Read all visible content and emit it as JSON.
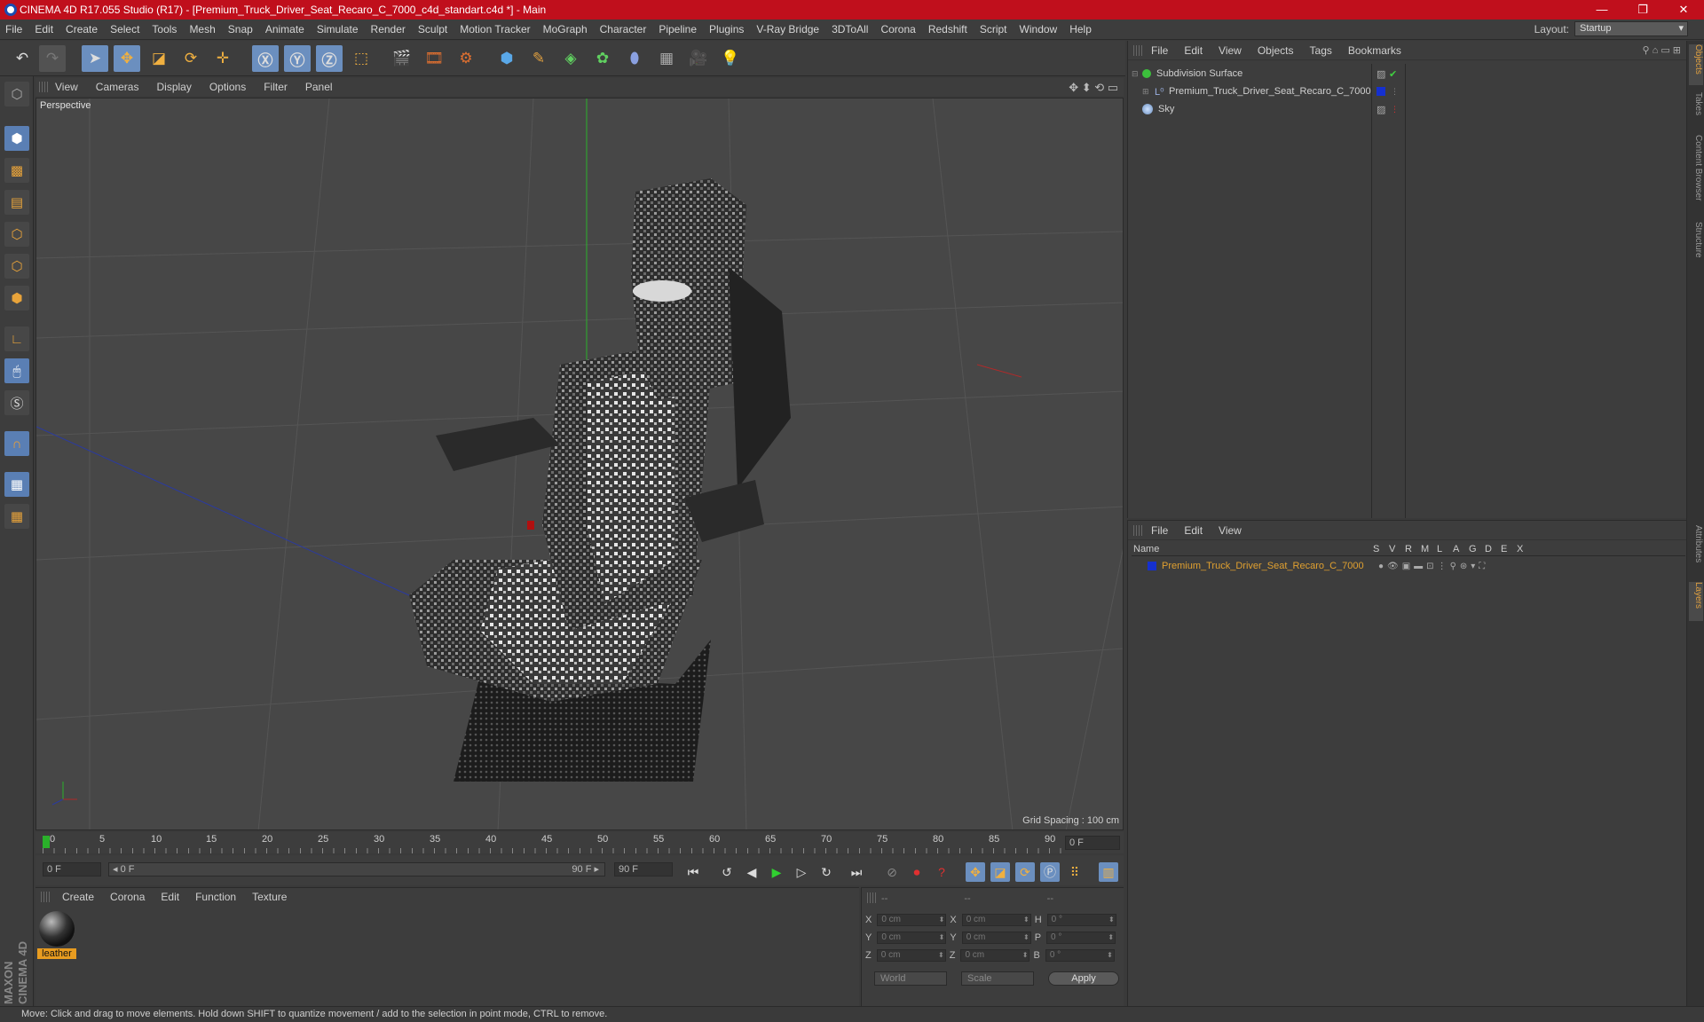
{
  "window": {
    "title": "CINEMA 4D R17.055 Studio (R17) - [Premium_Truck_Driver_Seat_Recaro_C_7000_c4d_standart.c4d *] - Main",
    "minimize": "—",
    "maximize": "❐",
    "close": "✕"
  },
  "menu": [
    "File",
    "Edit",
    "Create",
    "Select",
    "Tools",
    "Mesh",
    "Snap",
    "Animate",
    "Simulate",
    "Render",
    "Sculpt",
    "Motion Tracker",
    "MoGraph",
    "Character",
    "Pipeline",
    "Plugins",
    "V-Ray Bridge",
    "3DToAll",
    "Corona",
    "Redshift",
    "Script",
    "Window",
    "Help"
  ],
  "layout": {
    "label": "Layout:",
    "value": "Startup"
  },
  "viewport": {
    "menu": [
      "View",
      "Cameras",
      "Display",
      "Options",
      "Filter",
      "Panel"
    ],
    "label": "Perspective",
    "grid_spacing": "Grid Spacing : 100 cm",
    "nav_icons": "✥ ⬍ ⟲ ▭"
  },
  "timeline": {
    "ticks": [
      "0",
      "5",
      "10",
      "15",
      "20",
      "25",
      "30",
      "35",
      "40",
      "45",
      "50",
      "55",
      "60",
      "65",
      "70",
      "75",
      "80",
      "85",
      "90"
    ],
    "frame_field": "0 F",
    "start_field": "0 F",
    "slider_left": "◂ 0 F",
    "slider_right": "90 F ▸",
    "end_field": "90 F"
  },
  "materials": {
    "menu": [
      "Create",
      "Corona",
      "Edit",
      "Function",
      "Texture"
    ],
    "items": [
      {
        "name": "leather"
      }
    ]
  },
  "coords": {
    "headers": [
      "--",
      "--",
      "--"
    ],
    "rows": [
      {
        "a": "X",
        "av": "0 cm",
        "b": "X",
        "bv": "0 cm",
        "c": "H",
        "cv": "0 °"
      },
      {
        "a": "Y",
        "av": "0 cm",
        "b": "Y",
        "bv": "0 cm",
        "c": "P",
        "cv": "0 °"
      },
      {
        "a": "Z",
        "av": "0 cm",
        "b": "Z",
        "bv": "0 cm",
        "c": "B",
        "cv": "0 °"
      }
    ],
    "world": "World",
    "scale": "Scale",
    "apply": "Apply"
  },
  "objects": {
    "menu": [
      "File",
      "Edit",
      "View",
      "Objects",
      "Tags",
      "Bookmarks"
    ],
    "items": [
      {
        "name": "Subdivision Surface"
      },
      {
        "name": "Premium_Truck_Driver_Seat_Recaro_C_7000"
      },
      {
        "name": "Sky"
      }
    ]
  },
  "layers": {
    "menu": [
      "File",
      "Edit",
      "View"
    ],
    "columns": [
      "Name",
      "S",
      "V",
      "R",
      "M",
      "L",
      "A",
      "G",
      "D",
      "E",
      "X"
    ],
    "items": [
      {
        "name": "Premium_Truck_Driver_Seat_Recaro_C_7000"
      }
    ]
  },
  "side_tabs": [
    "Objects",
    "Takes",
    "Content Browser",
    "Structure",
    "Attributes",
    "Layers"
  ],
  "status": "Move: Click and drag to move elements. Hold down SHIFT to quantize movement / add to the selection in point mode, CTRL to remove.",
  "brand": "MAXON CINEMA 4D",
  "colors": {
    "accent": "#6b8fbf",
    "title_bar": "#c00f1c",
    "layer_text": "#e0a030",
    "layer_swatch": "#1530d0"
  }
}
